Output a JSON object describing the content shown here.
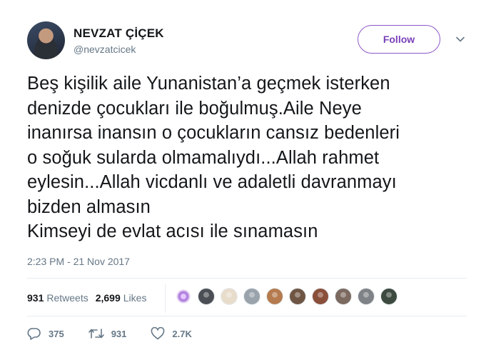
{
  "user": {
    "display_name": "NEVZAT ÇİÇEK",
    "handle": "@nevzatcicek"
  },
  "follow_label": "Follow",
  "tweet": {
    "text": "Beş kişilik aile Yunanistan’a geçmek isterken\ndenizde çocukları ile boğulmuş.Aile Neye\ninanırsa inansın o çocukların cansız bedenleri\no soğuk sularda olmamalıydı...Allah rahmet\neylesin...Allah vicdanlı ve adaletli davranmayı\nbizden almasın\nKimseyi de evlat acısı ile sınamasın",
    "timestamp": "2:23 PM - 21 Nov 2017"
  },
  "stats": {
    "retweets_count": "931",
    "retweets_label": "Retweets",
    "likes_count": "2,699",
    "likes_label": "Likes"
  },
  "likers": [
    {
      "icon": "avatar-purple-sparkle",
      "color": "#a46ad6"
    },
    {
      "icon": "avatar-dark",
      "color": "#4b4f55"
    },
    {
      "icon": "avatar-light",
      "color": "#e8dccb"
    },
    {
      "icon": "avatar-grey",
      "color": "#9aa3ab"
    },
    {
      "icon": "avatar-multi",
      "color": "#b57b4e"
    },
    {
      "icon": "avatar-brown",
      "color": "#6f5543"
    },
    {
      "icon": "avatar-couple",
      "color": "#8a4f3a"
    },
    {
      "icon": "avatar-portrait",
      "color": "#7c6a60"
    },
    {
      "icon": "avatar-bw",
      "color": "#7f8286"
    },
    {
      "icon": "avatar-darkgreen",
      "color": "#3d4a3f"
    }
  ],
  "actions": {
    "reply_count": "375",
    "retweet_count": "931",
    "like_count": "2.7K"
  },
  "colors": {
    "follow_accent": "#7a40b8",
    "muted_text": "#657786",
    "divider": "#e6ecf0"
  }
}
